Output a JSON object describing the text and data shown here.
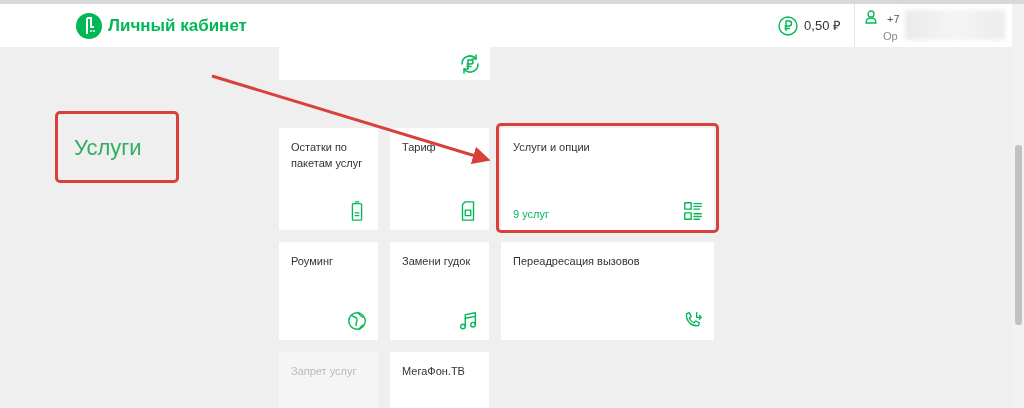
{
  "header": {
    "title": "Личный кабинет",
    "balance": "0,50 ₽",
    "phone": "+7",
    "phone_caption": "Ор"
  },
  "top_tile": {
    "kind": "ruble-cycle"
  },
  "tiles": [
    {
      "title": "Остатки по пакетам услуг",
      "kind": "battery",
      "wide": false,
      "disabled": false,
      "highlighted": false
    },
    {
      "title": "Тариф",
      "kind": "sim",
      "wide": false,
      "disabled": false,
      "highlighted": false
    },
    {
      "title": "Услуги и опции",
      "count": "9 услуг",
      "kind": "list",
      "wide": true,
      "disabled": false,
      "highlighted": true
    },
    {
      "title": "Роуминг",
      "kind": "globe",
      "wide": false,
      "disabled": false,
      "highlighted": false
    },
    {
      "title": "Замени гудок",
      "kind": "music",
      "wide": false,
      "disabled": false,
      "highlighted": false
    },
    {
      "title": "Переадресация вызовов",
      "kind": "phone-forward",
      "wide": true,
      "disabled": false,
      "highlighted": false
    },
    {
      "title": "Запрет услуг",
      "wide": false,
      "disabled": true,
      "highlighted": false
    },
    {
      "title": "МегаФон.ТВ",
      "wide": false,
      "disabled": false,
      "highlighted": false
    }
  ],
  "annotation": {
    "label": "Услуги"
  }
}
